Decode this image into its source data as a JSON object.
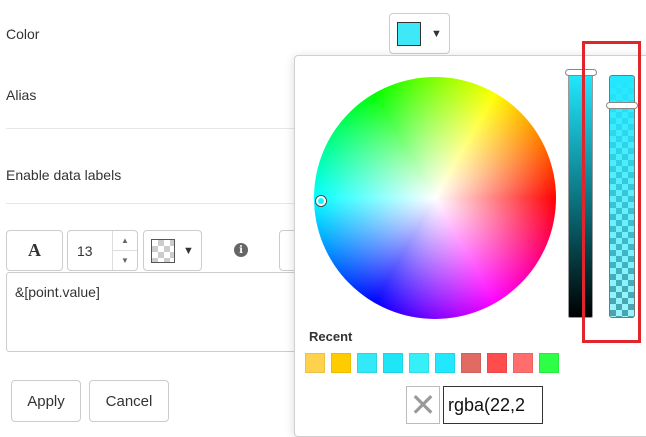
{
  "form": {
    "color_label": "Color",
    "alias_label": "Alias",
    "enable_data_labels_label": "Enable data labels",
    "font_button_label": "A",
    "font_size_value": "13",
    "label_template": "&[point.value]",
    "apply_label": "Apply",
    "cancel_label": "Cancel",
    "dropdown_caret": "▼",
    "info_icon": "info-icon",
    "current_color": "#3ee8f7"
  },
  "color_picker": {
    "recent_title": "Recent",
    "recent_colors": [
      "#ffd24d",
      "#ffcc00",
      "#33e8f7",
      "#1fe6f7",
      "#36f0f7",
      "#22e8ff",
      "#e16a62",
      "#ff4c4c",
      "#ff6d6d",
      "#2cff45"
    ],
    "rgba_value": "rgba(22,2",
    "no_color_icon": "x-icon",
    "selected_hue": "#22e8ff",
    "highlight_color": "#e0262c"
  }
}
